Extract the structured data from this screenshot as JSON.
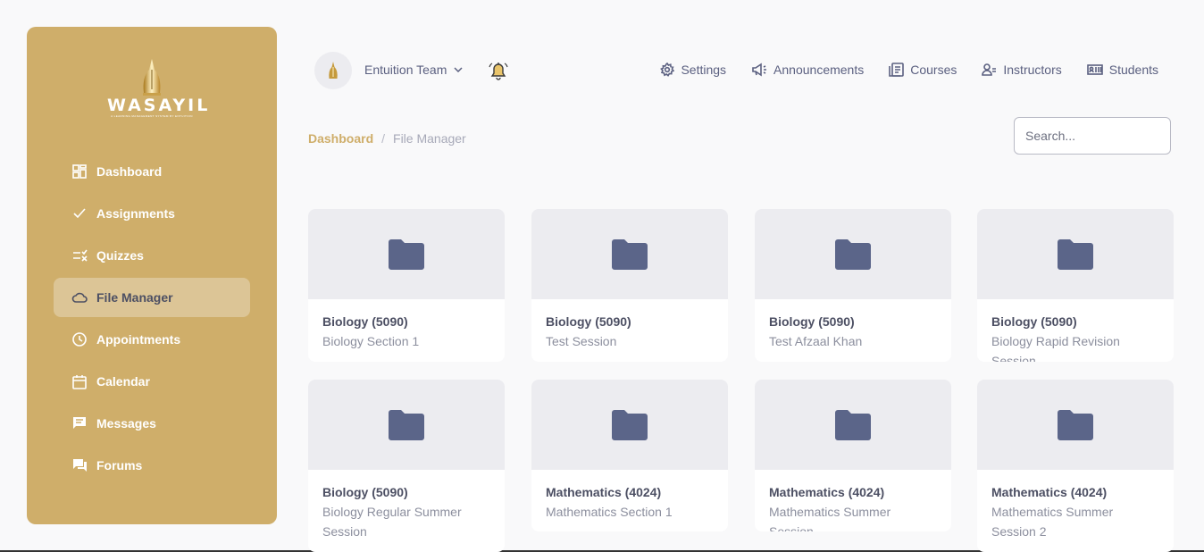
{
  "brand": {
    "name": "WASAYIL",
    "tagline": "A LEARNING MANAGEMENT SYSTEM BY ENTUITION",
    "color": "#cfae6a"
  },
  "sidebar": {
    "items": [
      {
        "label": "Dashboard",
        "icon": "dashboard-icon",
        "active": false
      },
      {
        "label": "Assignments",
        "icon": "check-icon",
        "active": false
      },
      {
        "label": "Quizzes",
        "icon": "quiz-list-icon",
        "active": false
      },
      {
        "label": "File Manager",
        "icon": "cloud-icon",
        "active": true
      },
      {
        "label": "Appointments",
        "icon": "clock-icon",
        "active": false
      },
      {
        "label": "Calendar",
        "icon": "calendar-icon",
        "active": false
      },
      {
        "label": "Messages",
        "icon": "message-icon",
        "active": false
      },
      {
        "label": "Forums",
        "icon": "forum-icon",
        "active": false
      }
    ]
  },
  "header": {
    "team_name": "Entuition Team",
    "nav": [
      {
        "label": "Settings",
        "icon": "gear-icon"
      },
      {
        "label": "Announcements",
        "icon": "megaphone-icon"
      },
      {
        "label": "Courses",
        "icon": "book-icon"
      },
      {
        "label": "Instructors",
        "icon": "instructor-icon"
      },
      {
        "label": "Students",
        "icon": "students-icon"
      }
    ]
  },
  "breadcrumb": {
    "home": "Dashboard",
    "separator": "/",
    "current": "File Manager"
  },
  "search": {
    "placeholder": "Search..."
  },
  "folders": [
    {
      "title": "Biology (5090)",
      "subtitle": "Biology Section 1"
    },
    {
      "title": "Biology (5090)",
      "subtitle": "Test Session"
    },
    {
      "title": "Biology (5090)",
      "subtitle": "Test Afzaal Khan"
    },
    {
      "title": "Biology (5090)",
      "subtitle": "Biology Rapid Revision Session"
    },
    {
      "title": "Biology (5090)",
      "subtitle": "Biology Regular Summer Session"
    },
    {
      "title": "Mathematics (4024)",
      "subtitle": "Mathematics Section 1"
    },
    {
      "title": "Mathematics (4024)",
      "subtitle": "Mathematics Summer Session"
    },
    {
      "title": "Mathematics (4024)",
      "subtitle": "Mathematics Summer Session 2"
    }
  ],
  "colors": {
    "folder": "#5b6589",
    "accent": "#cfae6a",
    "text": "#5b6080"
  }
}
